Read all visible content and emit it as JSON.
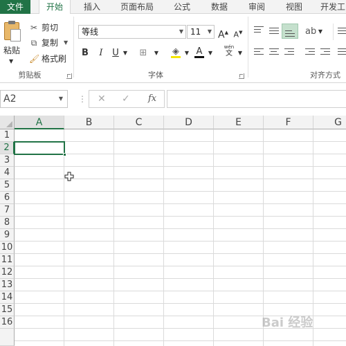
{
  "tabs": [
    "文件",
    "开始",
    "插入",
    "页面布局",
    "公式",
    "数据",
    "审阅",
    "视图",
    "开发工"
  ],
  "active_tab": "开始",
  "clipboard": {
    "paste_label": "粘贴",
    "cut_label": "剪切",
    "copy_label": "复制",
    "format_painter_label": "格式刷",
    "group_label": "剪贴板"
  },
  "font": {
    "font_name": "等线",
    "font_size": "11",
    "bold": "B",
    "italic": "I",
    "underline": "U",
    "grow": "A",
    "shrink": "A",
    "font_color_glyph": "A",
    "phonetic_glyph": "wén",
    "phonetic_glyph_bottom": "文",
    "group_label": "字体"
  },
  "alignment": {
    "group_label": "对齐方式"
  },
  "formula_bar": {
    "name_box": "A2",
    "cancel": "✕",
    "enter": "✓",
    "fx": "fx",
    "formula": ""
  },
  "columns": [
    "A",
    "B",
    "C",
    "D",
    "E",
    "F",
    "G"
  ],
  "rows": [
    "1",
    "2",
    "3",
    "4",
    "5",
    "6",
    "7",
    "8",
    "9",
    "10",
    "11",
    "12",
    "13",
    "14",
    "15",
    "16"
  ],
  "selected_cell": "A2",
  "accent_color": "#217346",
  "watermark": "Bai 经验"
}
